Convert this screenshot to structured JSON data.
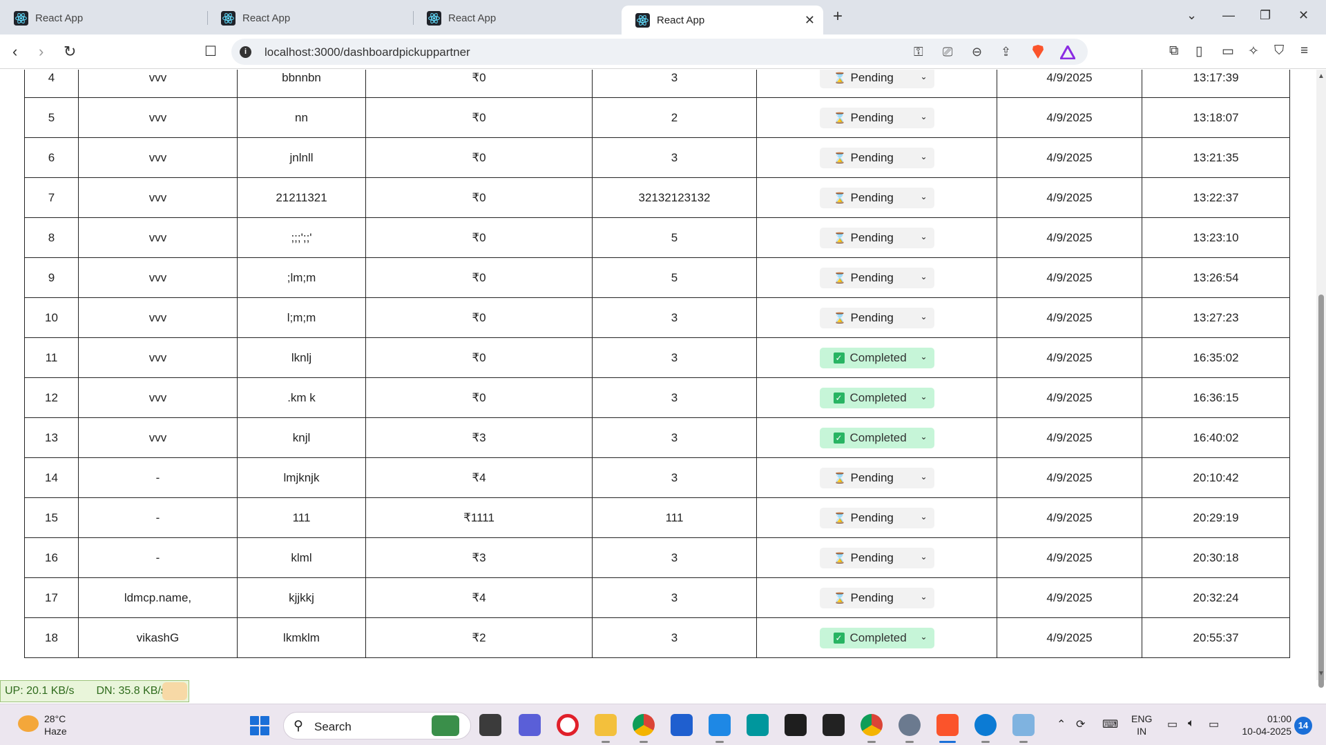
{
  "browser": {
    "tabs": [
      {
        "title": "React App",
        "active": false
      },
      {
        "title": "React App",
        "active": false
      },
      {
        "title": "React App",
        "active": false
      },
      {
        "title": "React App",
        "active": true
      }
    ],
    "url": "localhost:3000/dashboardpickuppartner"
  },
  "table": {
    "rows": [
      {
        "no": "4",
        "name": "vvv",
        "item": "bbnnbn",
        "amount": "₹0",
        "qty": "3",
        "status": "Pending",
        "date": "4/9/2025",
        "time": "13:17:39"
      },
      {
        "no": "5",
        "name": "vvv",
        "item": "nn",
        "amount": "₹0",
        "qty": "2",
        "status": "Pending",
        "date": "4/9/2025",
        "time": "13:18:07"
      },
      {
        "no": "6",
        "name": "vvv",
        "item": "jnlnll",
        "amount": "₹0",
        "qty": "3",
        "status": "Pending",
        "date": "4/9/2025",
        "time": "13:21:35"
      },
      {
        "no": "7",
        "name": "vvv",
        "item": "21211321",
        "amount": "₹0",
        "qty": "32132123132",
        "status": "Pending",
        "date": "4/9/2025",
        "time": "13:22:37"
      },
      {
        "no": "8",
        "name": "vvv",
        "item": ";;;';;'",
        "amount": "₹0",
        "qty": "5",
        "status": "Pending",
        "date": "4/9/2025",
        "time": "13:23:10"
      },
      {
        "no": "9",
        "name": "vvv",
        "item": ";lm;m",
        "amount": "₹0",
        "qty": "5",
        "status": "Pending",
        "date": "4/9/2025",
        "time": "13:26:54"
      },
      {
        "no": "10",
        "name": "vvv",
        "item": "l;m;m",
        "amount": "₹0",
        "qty": "3",
        "status": "Pending",
        "date": "4/9/2025",
        "time": "13:27:23"
      },
      {
        "no": "11",
        "name": "vvv",
        "item": "lknlj",
        "amount": "₹0",
        "qty": "3",
        "status": "Completed",
        "date": "4/9/2025",
        "time": "16:35:02"
      },
      {
        "no": "12",
        "name": "vvv",
        "item": ".km k",
        "amount": "₹0",
        "qty": "3",
        "status": "Completed",
        "date": "4/9/2025",
        "time": "16:36:15"
      },
      {
        "no": "13",
        "name": "vvv",
        "item": "knjl",
        "amount": "₹3",
        "qty": "3",
        "status": "Completed",
        "date": "4/9/2025",
        "time": "16:40:02"
      },
      {
        "no": "14",
        "name": "-",
        "item": "lmjknjk",
        "amount": "₹4",
        "qty": "3",
        "status": "Pending",
        "date": "4/9/2025",
        "time": "20:10:42"
      },
      {
        "no": "15",
        "name": "-",
        "item": "111",
        "amount": "₹1111",
        "qty": "111",
        "status": "Pending",
        "date": "4/9/2025",
        "time": "20:29:19"
      },
      {
        "no": "16",
        "name": "-",
        "item": "klml",
        "amount": "₹3",
        "qty": "3",
        "status": "Pending",
        "date": "4/9/2025",
        "time": "20:30:18"
      },
      {
        "no": "17",
        "name": "ldmcp.name,",
        "item": "kjjkkj",
        "amount": "₹4",
        "qty": "3",
        "status": "Pending",
        "date": "4/9/2025",
        "time": "20:32:24"
      },
      {
        "no": "18",
        "name": "vikashG",
        "item": "lkmklm",
        "amount": "₹2",
        "qty": "3",
        "status": "Completed",
        "date": "4/9/2025",
        "time": "20:55:37"
      }
    ]
  },
  "netmeter": {
    "up": "UP: 20.1 KB/s",
    "down": "DN: 35.8 KB/s"
  },
  "taskbar": {
    "weather_temp": "28°C",
    "weather_desc": "Haze",
    "search_label": "Search",
    "lang_line1": "ENG",
    "lang_line2": "IN",
    "time": "01:00",
    "date": "10-04-2025",
    "notifications": "14"
  },
  "colors": {
    "pending_bg": "#f2f2f2",
    "completed_bg": "#c6f5d8",
    "completed_check": "#28b463",
    "accent": "#1a6fd8"
  }
}
